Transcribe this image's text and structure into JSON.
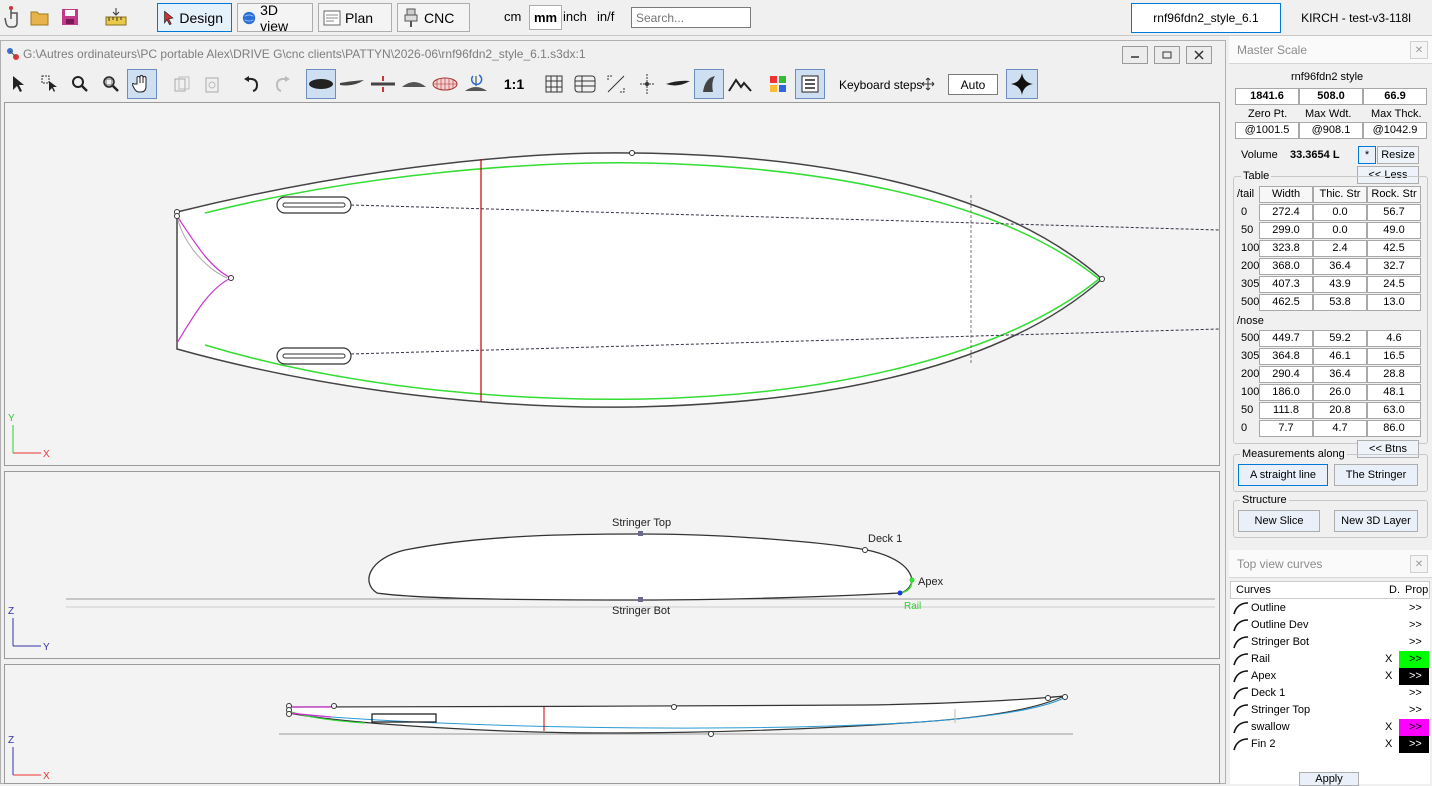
{
  "toolbar": {
    "modes": [
      {
        "label": "Design",
        "icon": "design-icon"
      },
      {
        "label": "3D view",
        "icon": "globe-icon"
      },
      {
        "label": "Plan",
        "icon": "plan-icon"
      },
      {
        "label": "CNC",
        "icon": "cnc-icon"
      }
    ],
    "units": [
      "cm",
      "mm",
      "inch",
      "in/f"
    ],
    "selected_unit": "mm",
    "search_placeholder": "Search...",
    "board_tab": "rnf96fdn2_style_6.1",
    "machine_tab": "KIRCH - test-v3-118l"
  },
  "document": {
    "path": "G:\\Autres ordinateurs\\PC portable Alex\\DRIVE G\\cnc clients\\PATTYN\\2026-06\\rnf96fdn2_style_6.1.s3dx:1",
    "scale_label": "1:1",
    "keyboard_steps_label": "Keyboard steps",
    "auto_label": "Auto"
  },
  "views": {
    "top": {
      "axis_v": "Y",
      "axis_h": "X"
    },
    "slice": {
      "axis_v": "Z",
      "axis_h": "Y",
      "labels": {
        "stringer_top": "Stringer Top",
        "deck": "Deck 1",
        "apex": "Apex",
        "stringer_bot": "Stringer Bot",
        "rail": "Rail"
      }
    },
    "side": {
      "axis_v": "Z",
      "axis_h": "X"
    }
  },
  "master_scale": {
    "title": "Master Scale",
    "board_name": "rnf96fdn2 style",
    "values": [
      "1841.6",
      "508.0",
      "66.9"
    ],
    "labels": [
      "Zero Pt.",
      "Max Wdt.",
      "Max Thck."
    ],
    "positions": [
      "@1001.5",
      "@908.1",
      "@1042.9"
    ],
    "volume_label": "Volume",
    "volume_value": "33.3654 L",
    "star_label": "*",
    "resize_label": "Resize",
    "less_label": "<< Less",
    "table_label": "Table",
    "tail_label": "/tail",
    "nose_label": "/nose",
    "headers": [
      "Width",
      "Thic. Str",
      "Rock. Str"
    ],
    "tail_rows": [
      {
        "pos": "0",
        "w": "272.4",
        "t": "0.0",
        "r": "56.7"
      },
      {
        "pos": "50",
        "w": "299.0",
        "t": "0.0",
        "r": "49.0"
      },
      {
        "pos": "100",
        "w": "323.8",
        "t": "2.4",
        "r": "42.5"
      },
      {
        "pos": "200",
        "w": "368.0",
        "t": "36.4",
        "r": "32.7"
      },
      {
        "pos": "305",
        "w": "407.3",
        "t": "43.9",
        "r": "24.5"
      },
      {
        "pos": "500",
        "w": "462.5",
        "t": "53.8",
        "r": "13.0"
      }
    ],
    "nose_rows": [
      {
        "pos": "500",
        "w": "449.7",
        "t": "59.2",
        "r": "4.6"
      },
      {
        "pos": "305",
        "w": "364.8",
        "t": "46.1",
        "r": "16.5"
      },
      {
        "pos": "200",
        "w": "290.4",
        "t": "36.4",
        "r": "28.8"
      },
      {
        "pos": "100",
        "w": "186.0",
        "t": "26.0",
        "r": "48.1"
      },
      {
        "pos": "50",
        "w": "111.8",
        "t": "20.8",
        "r": "63.0"
      },
      {
        "pos": "0",
        "w": "7.7",
        "t": "4.7",
        "r": "86.0"
      }
    ],
    "btns_label": "<< Btns",
    "measure_label": "Measurements along",
    "straight_label": "A straight line",
    "stringer_label": "The Stringer",
    "structure_label": "Structure",
    "new_slice_label": "New Slice",
    "new_layer_label": "New 3D Layer"
  },
  "curves_panel": {
    "title": "Top view curves",
    "col_curves": "Curves",
    "col_d": "D.",
    "col_prop": "Prop",
    "rows": [
      {
        "name": "Outline",
        "d": "",
        "prop": ">>",
        "color": ""
      },
      {
        "name": "Outline Dev",
        "d": "",
        "prop": ">>",
        "color": ""
      },
      {
        "name": "Stringer Bot",
        "d": "",
        "prop": ">>",
        "color": ""
      },
      {
        "name": "Rail",
        "d": "X",
        "prop": ">>",
        "color": "#00ff00"
      },
      {
        "name": "Apex",
        "d": "X",
        "prop": ">>",
        "color": "#000000"
      },
      {
        "name": "Deck 1",
        "d": "",
        "prop": ">>",
        "color": ""
      },
      {
        "name": "Stringer Top",
        "d": "",
        "prop": ">>",
        "color": ""
      },
      {
        "name": "swallow",
        "d": "X",
        "prop": ">>",
        "color": "#ff00ff"
      },
      {
        "name": "Fin 2",
        "d": "X",
        "prop": ">>",
        "color": "#000000"
      }
    ],
    "apply_label": "Apply"
  },
  "colors": {
    "outline": "#444444",
    "rail_green": "#33dd33",
    "swallow_magenta": "#cc33cc",
    "stringer_red": "#cc0000",
    "accent": "#0078d7"
  }
}
